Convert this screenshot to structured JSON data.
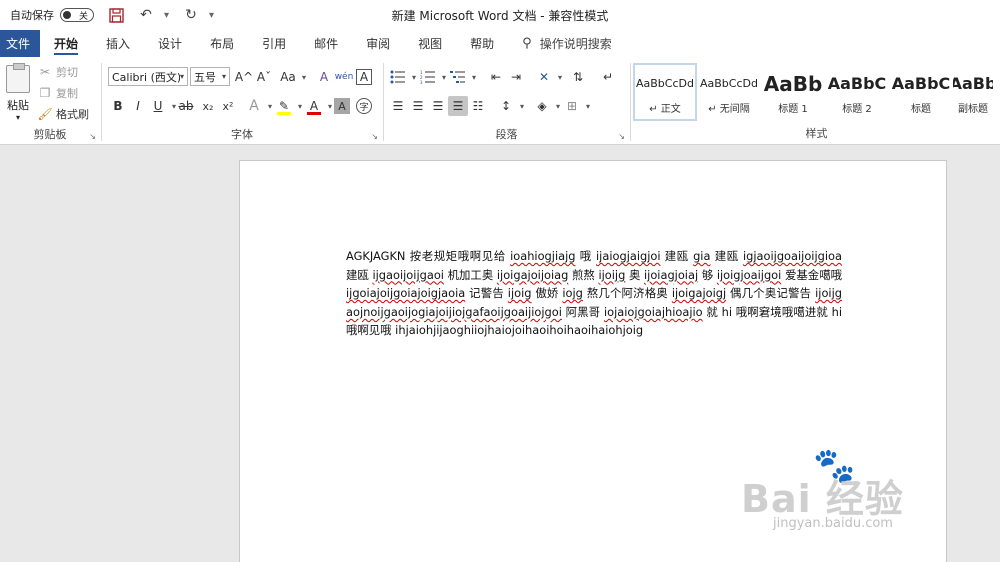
{
  "titlebar": {
    "autosave_label": "自动保存",
    "autosave_state": "关",
    "window_title": "新建 Microsoft Word 文档  -  兼容性模式",
    "qa_more": "▾"
  },
  "tabs": [
    {
      "label": "文件"
    },
    {
      "label": "开始"
    },
    {
      "label": "插入"
    },
    {
      "label": "设计"
    },
    {
      "label": "布局"
    },
    {
      "label": "引用"
    },
    {
      "label": "邮件"
    },
    {
      "label": "审阅"
    },
    {
      "label": "视图"
    },
    {
      "label": "帮助"
    },
    {
      "label": "操作说明搜索"
    }
  ],
  "clipboard": {
    "paste": "粘贴",
    "cut": "剪切",
    "copy": "复制",
    "format_painter": "格式刷",
    "group_label": "剪贴板"
  },
  "font": {
    "font_name": "Calibri (西文)",
    "font_size": "五号",
    "group_label": "字体",
    "grow": "A^",
    "shrink": "Aˇ",
    "case": "Aa",
    "clear": "A",
    "phonetic": "wén",
    "border": "A",
    "bold": "B",
    "italic": "I",
    "underline": "U",
    "strike": "ab",
    "subscript": "x₂",
    "superscript": "x²",
    "effects": "A",
    "highlight": "✎",
    "color": "A",
    "shading": "A",
    "enclose": "字",
    "highlight_color": "#ffff00",
    "font_color": "#e00000"
  },
  "paragraph": {
    "group_label": "段落"
  },
  "styles": {
    "group_label": "样式",
    "items": [
      {
        "sample": "AaBbCcDd",
        "name": "↵ 正文"
      },
      {
        "sample": "AaBbCcDd",
        "name": "↵ 无间隔"
      },
      {
        "sample": "AaBb",
        "name": "标题 1"
      },
      {
        "sample": "AaBbC",
        "name": "标题 2"
      },
      {
        "sample": "AaBbC",
        "name": "标题"
      },
      {
        "sample": "AaBb",
        "name": "副标题"
      }
    ]
  },
  "document": {
    "segments": [
      {
        "text": "AGKJAGKN 按老规矩哦啊见给 ",
        "err": false
      },
      {
        "text": "ioahiogjiajg",
        "err": true
      },
      {
        "text": " 哦 ",
        "err": false
      },
      {
        "text": "ijaiogjaigjoi",
        "err": true
      },
      {
        "text": " 建瓯 ",
        "err": false
      },
      {
        "text": "gia",
        "err": true
      },
      {
        "text": " 建瓯 ",
        "err": false
      },
      {
        "text": "igjaoijgoaijoijgioa",
        "err": true
      },
      {
        "text": " 建瓯 ",
        "err": false
      },
      {
        "text": "ijgaoijoijgaoi",
        "err": true
      },
      {
        "text": " 机加工奥 ",
        "err": false
      },
      {
        "text": "ijoigajoijoiag",
        "err": true
      },
      {
        "text": " 煎熬 ",
        "err": false
      },
      {
        "text": "ijoijg",
        "err": true
      },
      {
        "text": " 奥 ",
        "err": false
      },
      {
        "text": "ijoiagjoiaj",
        "err": true
      },
      {
        "text": " 够 ",
        "err": false
      },
      {
        "text": "ijoigjoaijgoi",
        "err": true
      },
      {
        "text": " 爱基金噶哦 ",
        "err": false
      },
      {
        "text": "ijgoiajoijgoiajoigjaoia",
        "err": true
      },
      {
        "text": " 记警告 ",
        "err": false
      },
      {
        "text": "ijoig",
        "err": true
      },
      {
        "text": " 傲娇 ",
        "err": false
      },
      {
        "text": "iojg",
        "err": true
      },
      {
        "text": " 熬几个阿济格奥 ",
        "err": false
      },
      {
        "text": "ijoigajoigj",
        "err": true
      },
      {
        "text": " 偶几个奥记警告 ",
        "err": false
      },
      {
        "text": "ijoijgaojnoijgaoijogiajoijiojgafaoijgoaijiojgoi",
        "err": true
      },
      {
        "text": " 阿黑哥 ",
        "err": false
      },
      {
        "text": "iojaiojgoiajhioajio",
        "err": true
      },
      {
        "text": " 就 hi 哦啊窘境哦噶进就 hi 哦啊见哦 ihjaiohjijaoghiiojhaiojoihaoihoihaoihaiohjoig",
        "err": false
      }
    ]
  },
  "watermark": {
    "brand": "Bai 经验",
    "url": "jingyan.baidu.com"
  }
}
